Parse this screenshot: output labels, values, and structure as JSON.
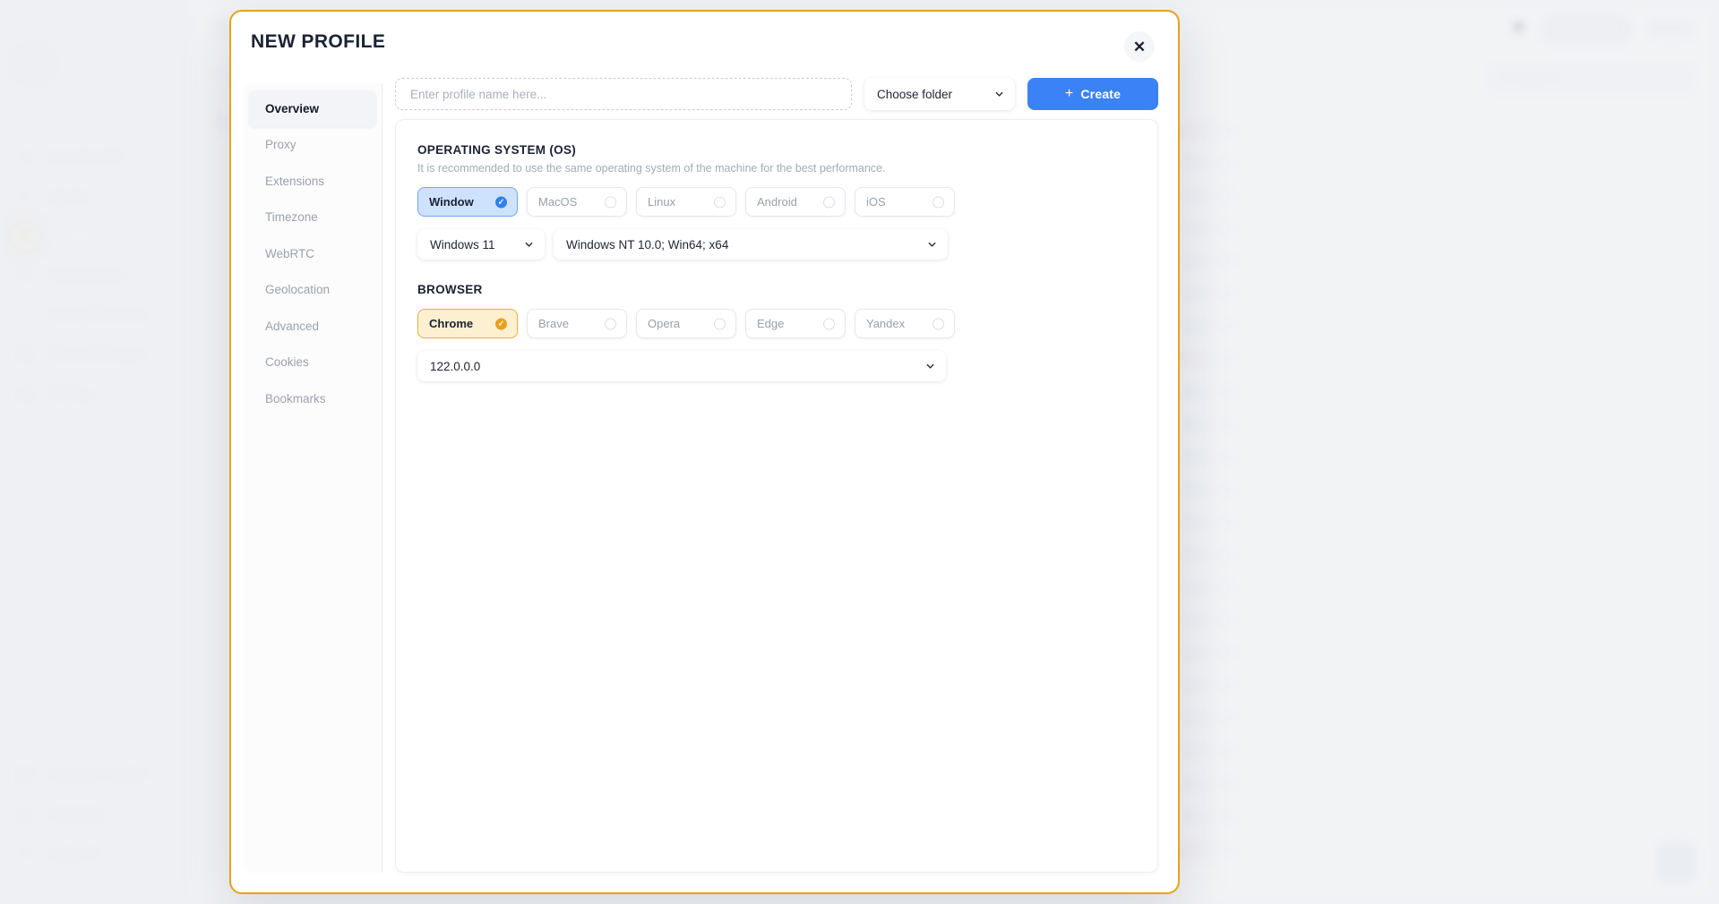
{
  "background": {
    "page_title": "PROFILES",
    "buy_button": "Buy Code",
    "folders_label": "FOLDERS",
    "all_label": "All",
    "search_placeholder": "Search",
    "sidebar": {
      "items": [
        {
          "label": "New Profile",
          "icon": "plus-icon",
          "active": false
        },
        {
          "label": "Quick",
          "icon": "sparkle-icon",
          "active": false
        },
        {
          "label": "Profiles",
          "icon": "profiles-icon",
          "active": true
        },
        {
          "label": "Automation",
          "icon": "automation-icon",
          "active": false
        },
        {
          "label": "Team Members",
          "icon": "team-icon",
          "active": false
        },
        {
          "label": "Proxy Manager",
          "icon": "proxy-icon",
          "active": false
        },
        {
          "label": "Billing",
          "icon": "billing-icon",
          "active": false
        }
      ],
      "bottom_items": [
        {
          "label": "Support Center",
          "icon": "support-icon"
        },
        {
          "label": "Settings",
          "icon": "gear-icon"
        },
        {
          "label": "Log out",
          "icon": "logout-icon"
        }
      ]
    }
  },
  "modal": {
    "title": "NEW PROFILE",
    "close_icon": "close-icon",
    "nav": {
      "items": [
        {
          "label": "Overview",
          "active": true
        },
        {
          "label": "Proxy",
          "active": false
        },
        {
          "label": "Extensions",
          "active": false
        },
        {
          "label": "Timezone",
          "active": false
        },
        {
          "label": "WebRTC",
          "active": false
        },
        {
          "label": "Geolocation",
          "active": false
        },
        {
          "label": "Advanced",
          "active": false
        },
        {
          "label": "Cookies",
          "active": false
        },
        {
          "label": "Bookmarks",
          "active": false
        }
      ]
    },
    "toolbar": {
      "name_placeholder": "Enter profile name here...",
      "name_value": "",
      "folder_value": "Choose folder",
      "create_label": "Create",
      "create_icon": "plus-icon",
      "create_color": "#3b82f6"
    },
    "os_section": {
      "title": "OPERATING SYSTEM (OS)",
      "description": "It is recommended to use the same operating system of the machine for the best performance.",
      "options": [
        {
          "label": "Window",
          "selected": true
        },
        {
          "label": "MacOS",
          "selected": false
        },
        {
          "label": "Linux",
          "selected": false
        },
        {
          "label": "Android",
          "selected": false
        },
        {
          "label": "iOS",
          "selected": false
        }
      ],
      "version_value": "Windows 11",
      "user_agent_value": "Windows NT 10.0; Win64; x64",
      "accent_color": "#2f80ed"
    },
    "browser_section": {
      "title": "BROWSER",
      "options": [
        {
          "label": "Chrome",
          "selected": true
        },
        {
          "label": "Brave",
          "selected": false
        },
        {
          "label": "Opera",
          "selected": false
        },
        {
          "label": "Edge",
          "selected": false
        },
        {
          "label": "Yandex",
          "selected": false
        }
      ],
      "version_value": "122.0.0.0",
      "accent_color": "#e8a11c"
    },
    "border_color": "#e8a11c",
    "check_glyph": "✓"
  }
}
